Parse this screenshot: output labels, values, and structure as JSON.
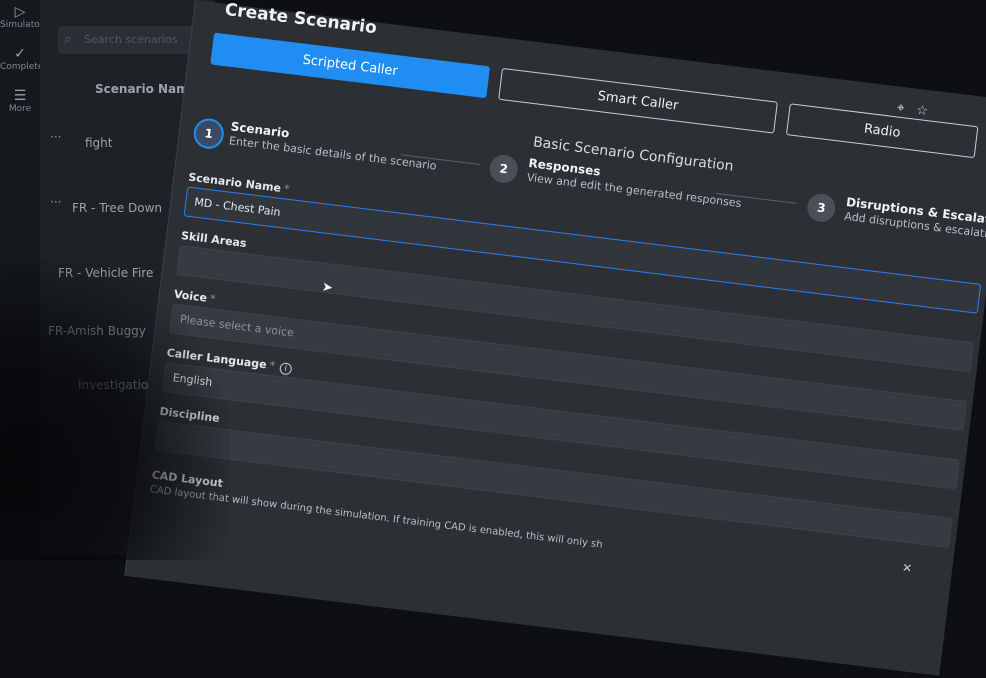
{
  "rail": {
    "items": [
      {
        "icon": "play-icon",
        "label": "Simulator"
      },
      {
        "icon": "check-icon",
        "label": "Completed"
      },
      {
        "icon": "list-icon",
        "label": "More"
      }
    ]
  },
  "list": {
    "search_placeholder": "Search scenarios",
    "header": "Scenario Name",
    "rows": [
      {
        "name": "fight"
      },
      {
        "name": "FR - Tree Down"
      },
      {
        "name": "FR - Vehicle Fire"
      },
      {
        "name": "FR-Amish Buggy"
      },
      {
        "name": "Investigation"
      }
    ]
  },
  "main": {
    "title": "Create Scenario",
    "tabs": [
      {
        "label": "Scripted Caller",
        "active": true
      },
      {
        "label": "Smart Caller",
        "active": false
      },
      {
        "label": "Radio",
        "active": false
      }
    ],
    "config_title": "Basic Scenario Configuration",
    "steps": [
      {
        "number": "1",
        "title": "Scenario",
        "subtitle": "Enter the basic details of the scenario"
      },
      {
        "number": "2",
        "title": "Responses",
        "subtitle": "View and edit the generated responses"
      },
      {
        "number": "3",
        "title": "Disruptions & Escalation",
        "subtitle": "Add disruptions & escalation"
      }
    ],
    "fields": {
      "scenario_name": {
        "label": "Scenario Name",
        "required": "*",
        "value": "MD - Chest Pain"
      },
      "skill_areas": {
        "label": "Skill Areas",
        "value": ""
      },
      "voice": {
        "label": "Voice",
        "required": "*",
        "placeholder": "Please select a voice"
      },
      "caller_language": {
        "label": "Caller Language",
        "required": "*",
        "value": "English"
      },
      "discipline": {
        "label": "Discipline",
        "value": ""
      },
      "cad_layout": {
        "label": "CAD Layout",
        "subtitle": "CAD layout that will show during the simulation. If training CAD is enabled, this will only sh"
      }
    }
  }
}
